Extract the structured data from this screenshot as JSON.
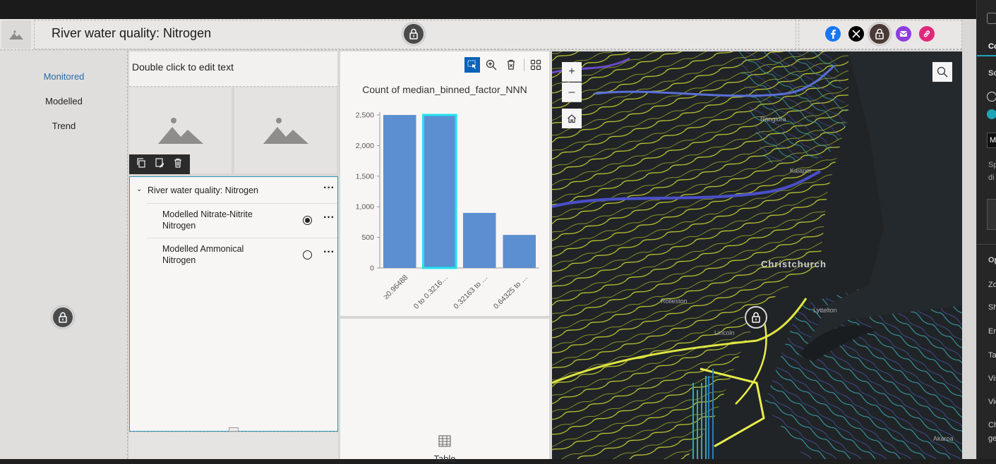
{
  "header": {
    "title": "River water quality: Nitrogen"
  },
  "nav": {
    "items": [
      {
        "label": "Monitored",
        "active": true
      },
      {
        "label": "Modelled",
        "active": false
      },
      {
        "label": "Trend",
        "active": false
      }
    ]
  },
  "text_widget": {
    "placeholder_text": "Double click to edit text"
  },
  "layer_list": {
    "group_title": "River water quality: Nitrogen",
    "layers": [
      {
        "label": "Modelled Nitrate-Nitrite Nitrogen",
        "line1": "Modelled Nitrate-Nitrite",
        "line2": "Nitrogen",
        "selected": true
      },
      {
        "label": "Modelled Ammonical Nitrogen",
        "line1": "Modelled Ammonical",
        "line2": "Nitrogen",
        "selected": false
      }
    ]
  },
  "chart_data": {
    "type": "bar",
    "title": "Count of median_binned_factor_NNN",
    "categories": [
      "≥0.96488",
      "0 to 0.3216…",
      "0.32163 to …",
      "0.64325 to …"
    ],
    "values": [
      2500,
      2500,
      900,
      540
    ],
    "highlighted_index": 1,
    "ylim": [
      0,
      2500
    ],
    "yticks": [
      "2,500",
      "2,000",
      "1,500",
      "1,000",
      "500",
      "0"
    ],
    "bar_color": "#5b8fd1",
    "highlight_color": "#21e3f0"
  },
  "table_widget": {
    "label": "Table"
  },
  "map": {
    "labels": [
      "Rangiora",
      "Kaiapoi",
      "Christchurch",
      "Rolleston",
      "Lincoln",
      "Lyttelton",
      "Akaroa"
    ],
    "zoom_in": "+",
    "zoom_out": "–"
  },
  "share": {
    "icons": [
      "facebook-icon",
      "x-icon",
      "lock-icon",
      "email-icon",
      "link-icon"
    ]
  },
  "right_panel": {
    "tab": "Co",
    "section1": "Sc",
    "input_value": "M",
    "desc1": "Sp",
    "desc2": "di",
    "section2": "Op",
    "options": [
      "Zo",
      "Sh",
      "En",
      "Ta",
      "Vis",
      "Vie",
      "Ch",
      "ge"
    ]
  }
}
